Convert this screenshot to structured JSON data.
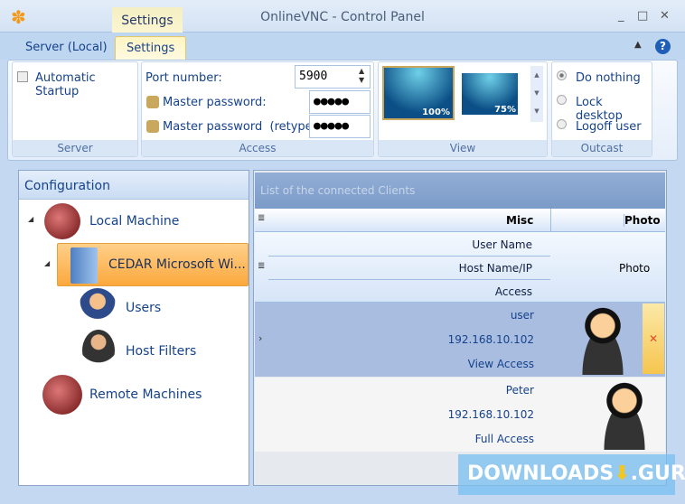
{
  "window": {
    "title": "OnlineVNC - Control Panel",
    "context_tab": "Settings",
    "controls": [
      "_",
      "□",
      "✕"
    ]
  },
  "tabs": [
    {
      "label": "Server (Local)"
    },
    {
      "label": "Settings"
    }
  ],
  "ribbon": {
    "server": {
      "label": "Server",
      "automatic_startup": "Automatic Startup",
      "checked": false
    },
    "access": {
      "label": "Access",
      "port_label": "Port number:",
      "port_value": "5900",
      "master_pw_label": "Master password:",
      "master_pw_value": "●●●●●",
      "retype_label": "Master password  (retype):",
      "retype_value": "●●●●●"
    },
    "view": {
      "label": "View",
      "options": [
        "100%",
        "75%"
      ],
      "selected": "100%"
    },
    "outcast": {
      "label": "Outcast",
      "options": [
        "Do nothing",
        "Lock desktop",
        "Logoff user"
      ],
      "selected": "Do nothing"
    }
  },
  "config": {
    "title": "Configuration",
    "items": [
      "Local Machine",
      "CEDAR Microsoft Wi...",
      "Users",
      "Host Filters",
      "Remote Machines"
    ]
  },
  "clients": {
    "title": "List of the connected Clients",
    "col_misc": "Misc",
    "col_photo": "Photo",
    "sub_headers": [
      "User Name",
      "Host Name/IP",
      "Access"
    ],
    "photo_header": "Photo",
    "rows": [
      {
        "user": "user",
        "host": "192.168.10.102",
        "access": "View Access"
      },
      {
        "user": "Peter",
        "host": "192.168.10.102",
        "access": "Full Access"
      }
    ]
  },
  "watermark": "DOWNLOADS",
  "watermark2": ".GURU"
}
